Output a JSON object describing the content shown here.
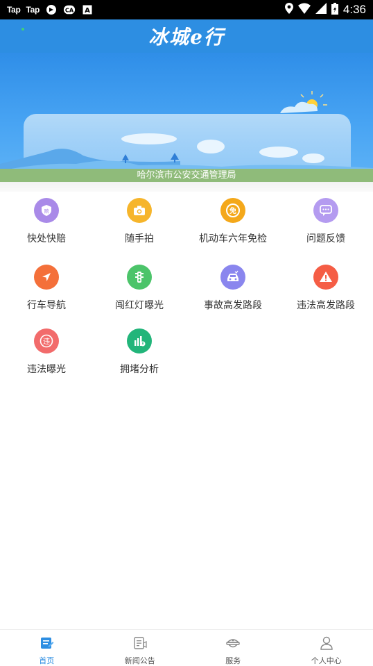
{
  "status_bar": {
    "left_apps": [
      "Tap",
      "Tap"
    ],
    "time": "4:36"
  },
  "header": {
    "title": "冰城e行"
  },
  "banner": {
    "caption": "哈尔滨市公安交通管理局"
  },
  "services": [
    {
      "label": "快处快赔",
      "icon": "insurance-icon",
      "color": "#a98ae8"
    },
    {
      "label": "随手拍",
      "icon": "camera-icon",
      "color": "#f6b52b"
    },
    {
      "label": "机动车六年免检",
      "icon": "exemption-icon",
      "color": "#f4a81a"
    },
    {
      "label": "问题反馈",
      "icon": "chat-icon",
      "color": "#b49bf0"
    },
    {
      "label": "行车导航",
      "icon": "navigation-icon",
      "color": "#f4703a"
    },
    {
      "label": "闯红灯曝光",
      "icon": "traffic-light-icon",
      "color": "#4cc46a"
    },
    {
      "label": "事故高发路段",
      "icon": "car-accident-icon",
      "color": "#8a86ee"
    },
    {
      "label": "违法高发路段",
      "icon": "warning-icon",
      "color": "#f55d45"
    },
    {
      "label": "违法曝光",
      "icon": "violation-icon",
      "color": "#f26b6b"
    },
    {
      "label": "拥堵分析",
      "icon": "congestion-chart-icon",
      "color": "#22b57a"
    }
  ],
  "tabbar": {
    "tabs": [
      {
        "label": "首页",
        "icon": "home-icon",
        "active": true
      },
      {
        "label": "新闻公告",
        "icon": "news-icon",
        "active": false
      },
      {
        "label": "服务",
        "icon": "service-icon",
        "active": false
      },
      {
        "label": "个人中心",
        "icon": "person-icon",
        "active": false
      }
    ],
    "active_color": "#2d8ee2"
  }
}
